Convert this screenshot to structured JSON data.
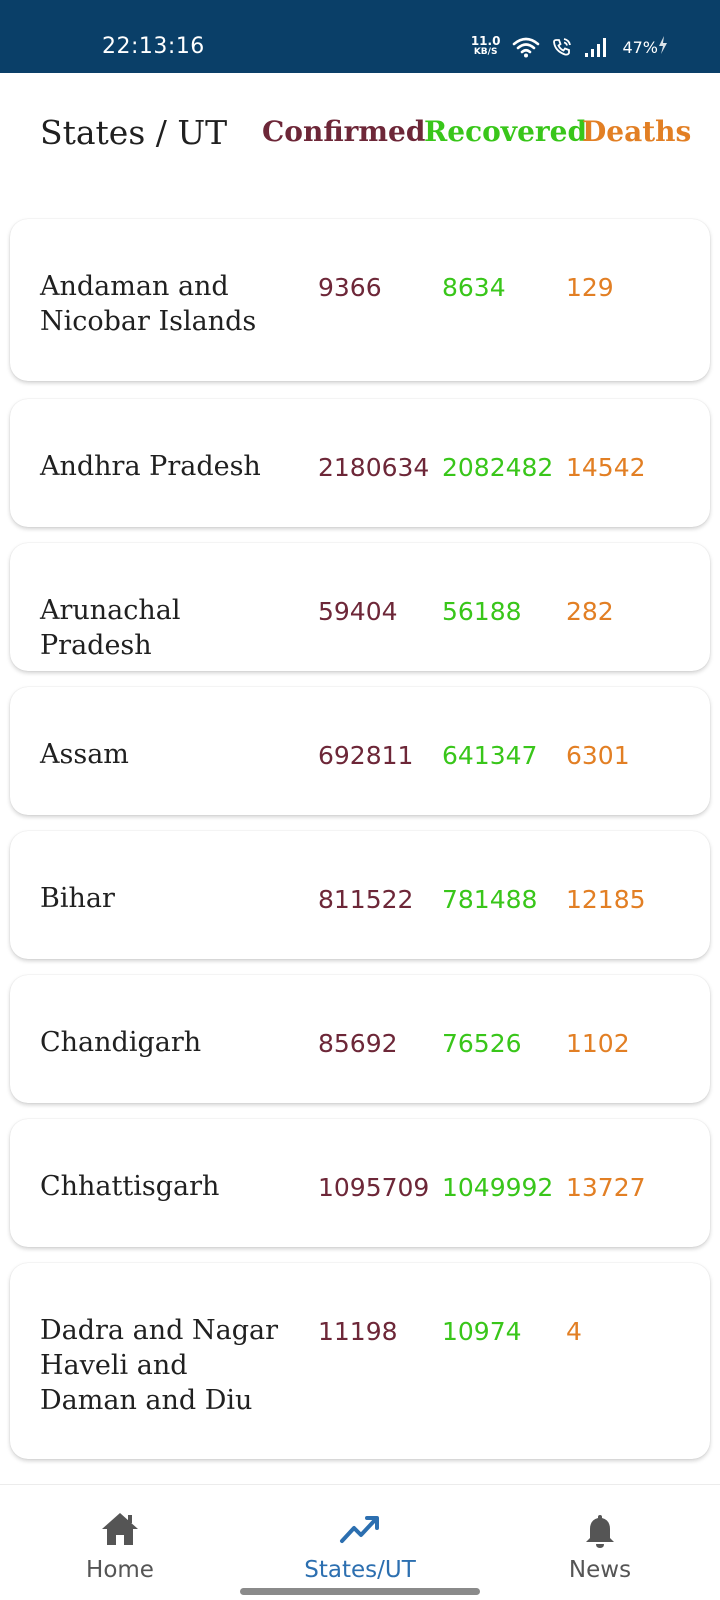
{
  "status_bar": {
    "time": "22:13:16",
    "net_speed_value": "11.0",
    "net_speed_unit": "KB/S",
    "battery": "47%"
  },
  "header": {
    "state": "States / UT",
    "confirmed": "Confirmed",
    "recovered": "Recovered",
    "deaths": "Deaths"
  },
  "colors": {
    "status_bar_bg": "#0a3f68",
    "confirmed": "#6d2738",
    "recovered": "#39c61a",
    "deaths": "#e27f24",
    "nav_active": "#2c6fb0"
  },
  "rows": [
    {
      "state": "Andaman and Nicobar Islands",
      "confirmed": "9366",
      "recovered": "8634",
      "deaths": "129"
    },
    {
      "state": "Andhra Pradesh",
      "confirmed": "2180634",
      "recovered": "2082482",
      "deaths": "14542"
    },
    {
      "state": "Arunachal Pradesh",
      "confirmed": "59404",
      "recovered": "56188",
      "deaths": "282"
    },
    {
      "state": "Assam",
      "confirmed": "692811",
      "recovered": "641347",
      "deaths": "6301"
    },
    {
      "state": "Bihar",
      "confirmed": "811522",
      "recovered": "781488",
      "deaths": "12185"
    },
    {
      "state": "Chandigarh",
      "confirmed": "85692",
      "recovered": "76526",
      "deaths": "1102"
    },
    {
      "state": "Chhattisgarh",
      "confirmed": "1095709",
      "recovered": "1049992",
      "deaths": "13727"
    },
    {
      "state": "Dadra and Nagar Haveli and Daman and Diu",
      "confirmed": "11198",
      "recovered": "10974",
      "deaths": "4"
    }
  ],
  "nav": {
    "home": "Home",
    "states": "States/UT",
    "news": "News",
    "active": "states"
  }
}
